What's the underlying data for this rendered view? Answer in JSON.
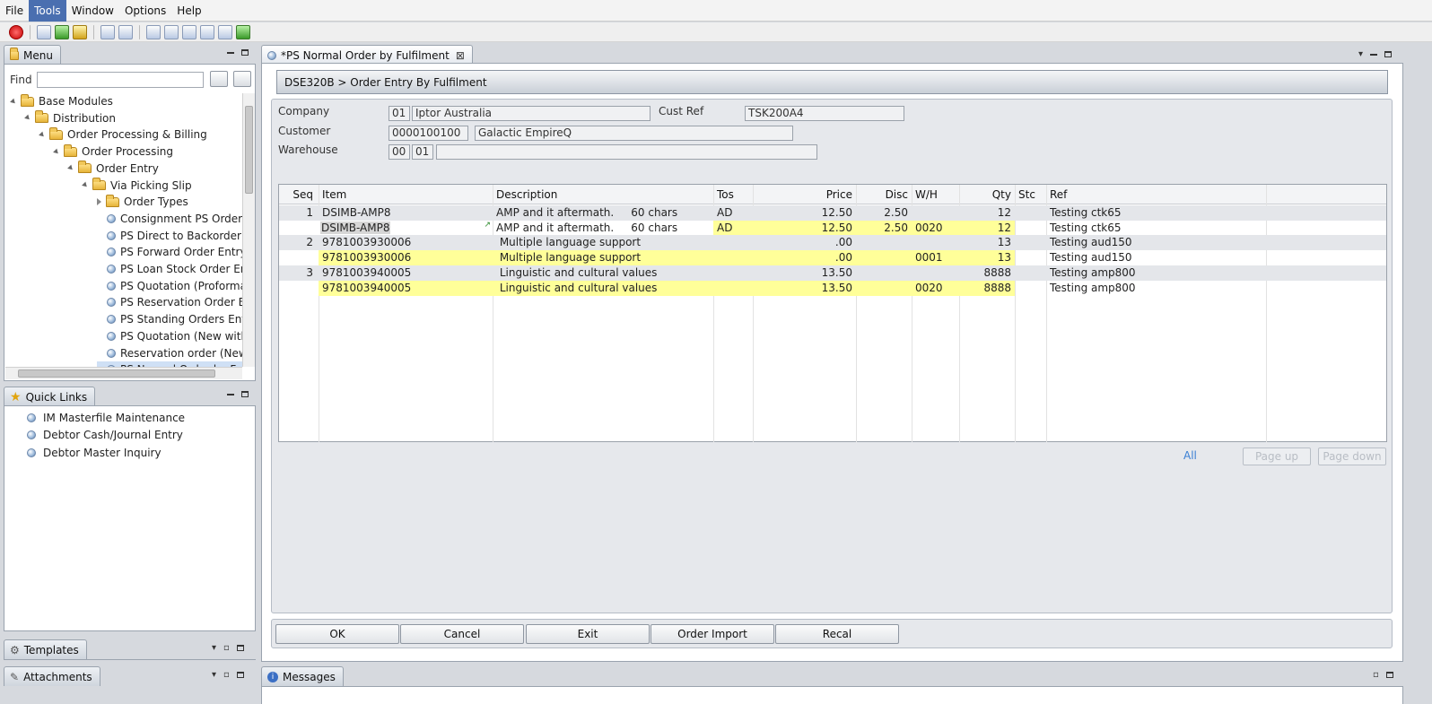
{
  "menubar": {
    "items": [
      "File",
      "Tools",
      "Window",
      "Options",
      "Help"
    ],
    "active": "Tools"
  },
  "menu_panel": {
    "title": "Menu",
    "find_label": "Find",
    "find_value": "",
    "tree": [
      {
        "label": "Base Modules",
        "icon": "folder-icon",
        "level": 0
      },
      {
        "label": "Distribution",
        "icon": "folder-icon",
        "level": 1
      },
      {
        "label": "Order Processing & Billing",
        "icon": "folder-icon",
        "level": 2
      },
      {
        "label": "Order Processing",
        "icon": "folder-icon",
        "level": 3
      },
      {
        "label": "Order Entry",
        "icon": "folder-icon",
        "level": 4
      },
      {
        "label": "Via Picking Slip",
        "icon": "folder-icon",
        "level": 5
      },
      {
        "label": "Order Types",
        "icon": "folder-icon",
        "level": 6
      },
      {
        "label": "Consignment PS Order I",
        "icon": "item-icon",
        "level": 6
      },
      {
        "label": "PS Direct to Backorder I",
        "icon": "item-icon",
        "level": 6
      },
      {
        "label": "PS Forward Order Entry",
        "icon": "item-icon",
        "level": 6
      },
      {
        "label": "PS Loan Stock Order En",
        "icon": "item-icon",
        "level": 6
      },
      {
        "label": "PS Quotation (Proforma",
        "icon": "item-icon",
        "level": 6
      },
      {
        "label": "PS Reservation Order Er",
        "icon": "item-icon",
        "level": 6
      },
      {
        "label": "PS Standing Orders Ent",
        "icon": "item-icon",
        "level": 6
      },
      {
        "label": "PS Quotation (New with",
        "icon": "item-icon",
        "level": 6
      },
      {
        "label": "Reservation order (New",
        "icon": "item-icon",
        "level": 6
      },
      {
        "label": "PS Normal Order by Ful",
        "icon": "item-icon",
        "level": 6
      }
    ]
  },
  "quick_links": {
    "title": "Quick Links",
    "items": [
      "IM Masterfile Maintenance",
      "Debtor Cash/Journal Entry",
      "Debtor Master Inquiry"
    ]
  },
  "templates_tab": "Templates",
  "attachments_tab": "Attachments",
  "messages_tab": "Messages",
  "doc_tab": {
    "title": "*PS Normal Order by Fulfilment"
  },
  "header": {
    "breadcrumb": "DSE320B > Order Entry By Fulfilment"
  },
  "form": {
    "company_label": "Company",
    "company_code": "01",
    "company_name": "Iptor Australia",
    "cust_ref_label": "Cust Ref",
    "cust_ref": "TSK200A4",
    "customer_label": "Customer",
    "customer_code": "0000100100",
    "customer_name": "Galactic EmpireQ",
    "warehouse_label": "Warehouse",
    "warehouse_1": "00",
    "warehouse_2": "01",
    "warehouse_3": ""
  },
  "grid": {
    "columns": [
      "Seq",
      "Item",
      "Description",
      "Tos",
      "Price",
      "Disc",
      "W/H",
      "Qty",
      "Stc",
      "Ref"
    ],
    "rows": [
      {
        "seq": "1",
        "item": "DSIMB-AMP8",
        "desc": "AMP and it aftermath.     60 chars",
        "tos": "AD",
        "price": "12.50",
        "disc": "2.50",
        "wh": "",
        "qty": "12",
        "stc": "",
        "ref": "Testing ctk65",
        "style": "odd"
      },
      {
        "seq": "",
        "item": "DSIMB-AMP8",
        "desc": "AMP and it aftermath.     60 chars",
        "tos": "AD",
        "price": "12.50",
        "disc": "2.50",
        "wh": "0020",
        "qty": "12",
        "stc": "",
        "ref": "Testing ctk65",
        "style": "edit"
      },
      {
        "seq": "2",
        "item": "9781003930006",
        "desc": " Multiple language support",
        "tos": "",
        "price": ".00",
        "disc": "",
        "wh": "",
        "qty": "13",
        "stc": "",
        "ref": "Testing aud150",
        "style": "odd"
      },
      {
        "seq": "",
        "item": "9781003930006",
        "desc": " Multiple language support",
        "tos": "",
        "price": ".00",
        "disc": "",
        "wh": "0001",
        "qty": "13",
        "stc": "",
        "ref": "Testing aud150",
        "style": "yellow"
      },
      {
        "seq": "3",
        "item": "9781003940005",
        "desc": " Linguistic and cultural values",
        "tos": "",
        "price": "13.50",
        "disc": "",
        "wh": "",
        "qty": "8888",
        "stc": "",
        "ref": "Testing amp800",
        "style": "odd"
      },
      {
        "seq": "",
        "item": "9781003940005",
        "desc": " Linguistic and cultural values",
        "tos": "",
        "price": "13.50",
        "disc": "",
        "wh": "0020",
        "qty": "8888",
        "stc": "",
        "ref": "Testing amp800",
        "style": "yellow"
      }
    ]
  },
  "paging": {
    "all": "All",
    "page_up": "Page up",
    "page_down": "Page down"
  },
  "buttons": [
    "OK",
    "Cancel",
    "Exit",
    "Order Import",
    "Recal"
  ]
}
